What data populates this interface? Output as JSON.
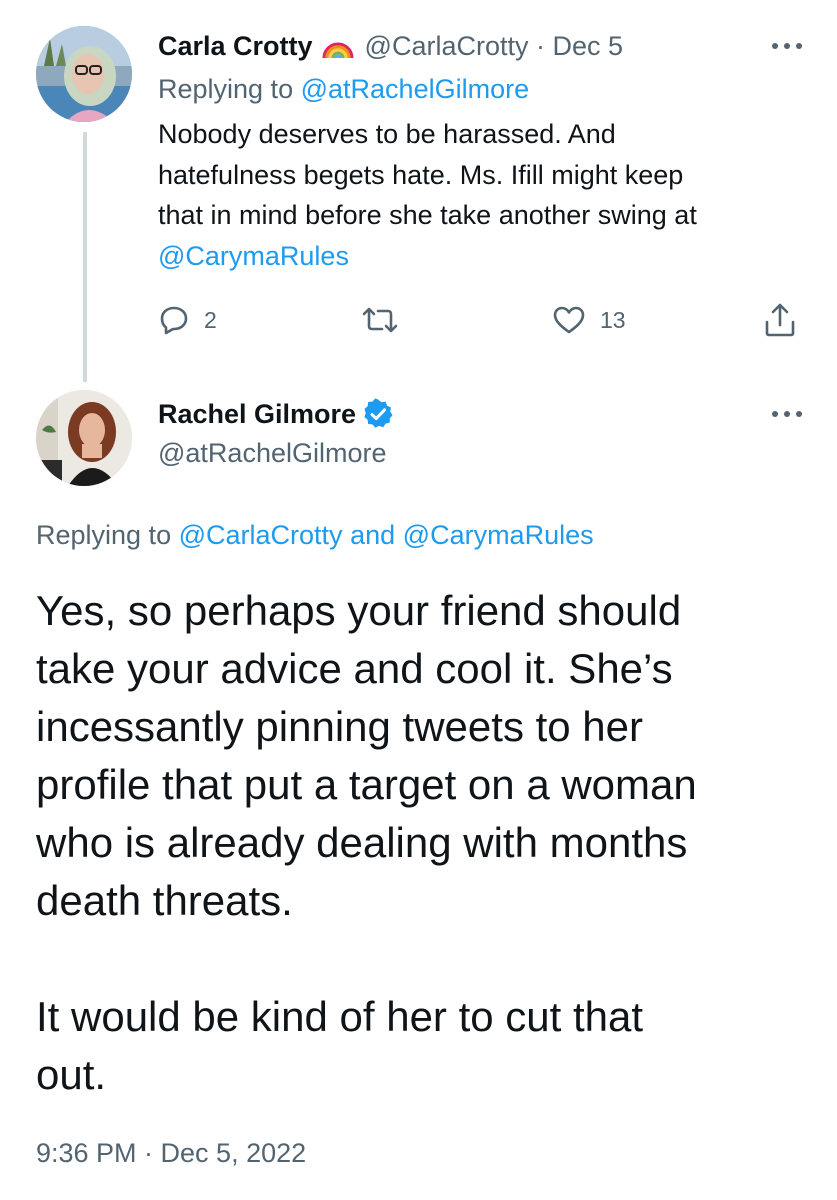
{
  "tweet1": {
    "display_name": "Carla Crotty",
    "handle_date": "@CarlaCrotty · Dec 5",
    "replying_prefix": "Replying to",
    "replying_to": "@atRachelGilmore",
    "text_lines": [
      "Nobody deserves to be harassed. And",
      "hatefulness begets hate. Ms. Ifill might keep",
      "that in mind before she take another swing at"
    ],
    "mention": "@CarymaRules",
    "reply_count": "2",
    "like_count": "13",
    "icons": [
      "rainbow-icon",
      "more-icon",
      "reply-icon",
      "retweet-icon",
      "like-icon",
      "share-icon"
    ]
  },
  "tweet2": {
    "display_name": "Rachel Gilmore",
    "handle": "@atRachelGilmore",
    "replying_prefix": "Replying to",
    "replying_to_1": "@CarlaCrotty",
    "replying_and": "and",
    "replying_to_2": "@CarymaRules",
    "text_lines": [
      "Yes, so perhaps your friend should",
      "take your advice and cool it. She’s",
      "incessantly pinning tweets to her",
      "profile that put a target on a woman",
      "who is already dealing with months",
      "death threats."
    ],
    "text_lines_2": [
      "It would be kind of her to cut that",
      "out."
    ],
    "timestamp": "9:36 PM · Dec 5, 2022",
    "icons": [
      "verified-badge-icon",
      "more-icon"
    ]
  },
  "colors": {
    "link": "#1d9bf0",
    "secondary_text": "#536471",
    "primary_text": "#0f1419",
    "verified": "#1d9bf0",
    "thread_line": "#cfd9de"
  }
}
